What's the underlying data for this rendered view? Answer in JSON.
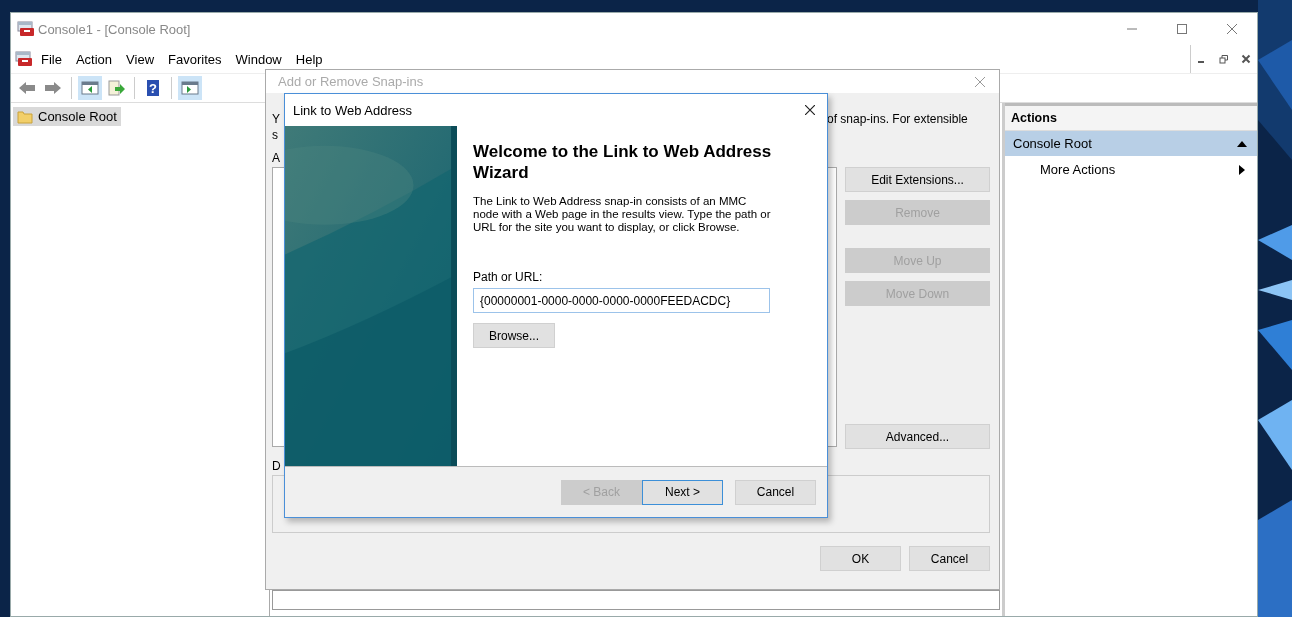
{
  "window": {
    "title": "Console1 - [Console Root]"
  },
  "menu": [
    "File",
    "Action",
    "View",
    "Favorites",
    "Window",
    "Help"
  ],
  "toolbar": [
    {
      "kind": "back",
      "pressed": false
    },
    {
      "kind": "forward",
      "pressed": false
    },
    {
      "kind": "tree",
      "pressed": true
    },
    {
      "kind": "export",
      "pressed": false
    },
    {
      "kind": "help",
      "pressed": false,
      "glyph": "?"
    },
    {
      "kind": "actionpane",
      "pressed": true
    }
  ],
  "tree": [
    {
      "label": "Console Root",
      "selected": true
    }
  ],
  "actions": {
    "header": "Actions",
    "groups": [
      {
        "label": "Console Root",
        "expanded": true,
        "items": [
          "More Actions"
        ]
      }
    ]
  },
  "snapin_dialog": {
    "title": "Add or Remove Snap-ins",
    "intro_left": [
      "Y",
      "s"
    ],
    "intro_right": "of snap-ins. For extensible",
    "list_label": "A",
    "description_label": "D",
    "side_buttons": [
      {
        "label": "Edit Extensions...",
        "disabled": false
      },
      {
        "label": "Remove",
        "disabled": true
      },
      {
        "label": "Move Up",
        "disabled": true
      },
      {
        "label": "Move Down",
        "disabled": true
      },
      {
        "label": "Advanced...",
        "disabled": false
      }
    ],
    "buttons": [
      "OK",
      "Cancel"
    ]
  },
  "wizard": {
    "title": "Link to Web Address",
    "heading": "Welcome to the Link to Web Address Wizard",
    "description": "The Link to Web Address snap-in consists of an MMC node with a Web page in the results view. Type the path or URL for the site you want to display, or click Browse.",
    "field_label": "Path or URL:",
    "field_value": "{00000001-0000-0000-0000-0000FEEDACDC}",
    "browse": "Browse...",
    "buttons": [
      {
        "label": "< Back",
        "disabled": true,
        "default": false
      },
      {
        "label": "Next >",
        "disabled": false,
        "default": true
      },
      {
        "label": "Cancel",
        "disabled": false,
        "default": false
      }
    ]
  }
}
